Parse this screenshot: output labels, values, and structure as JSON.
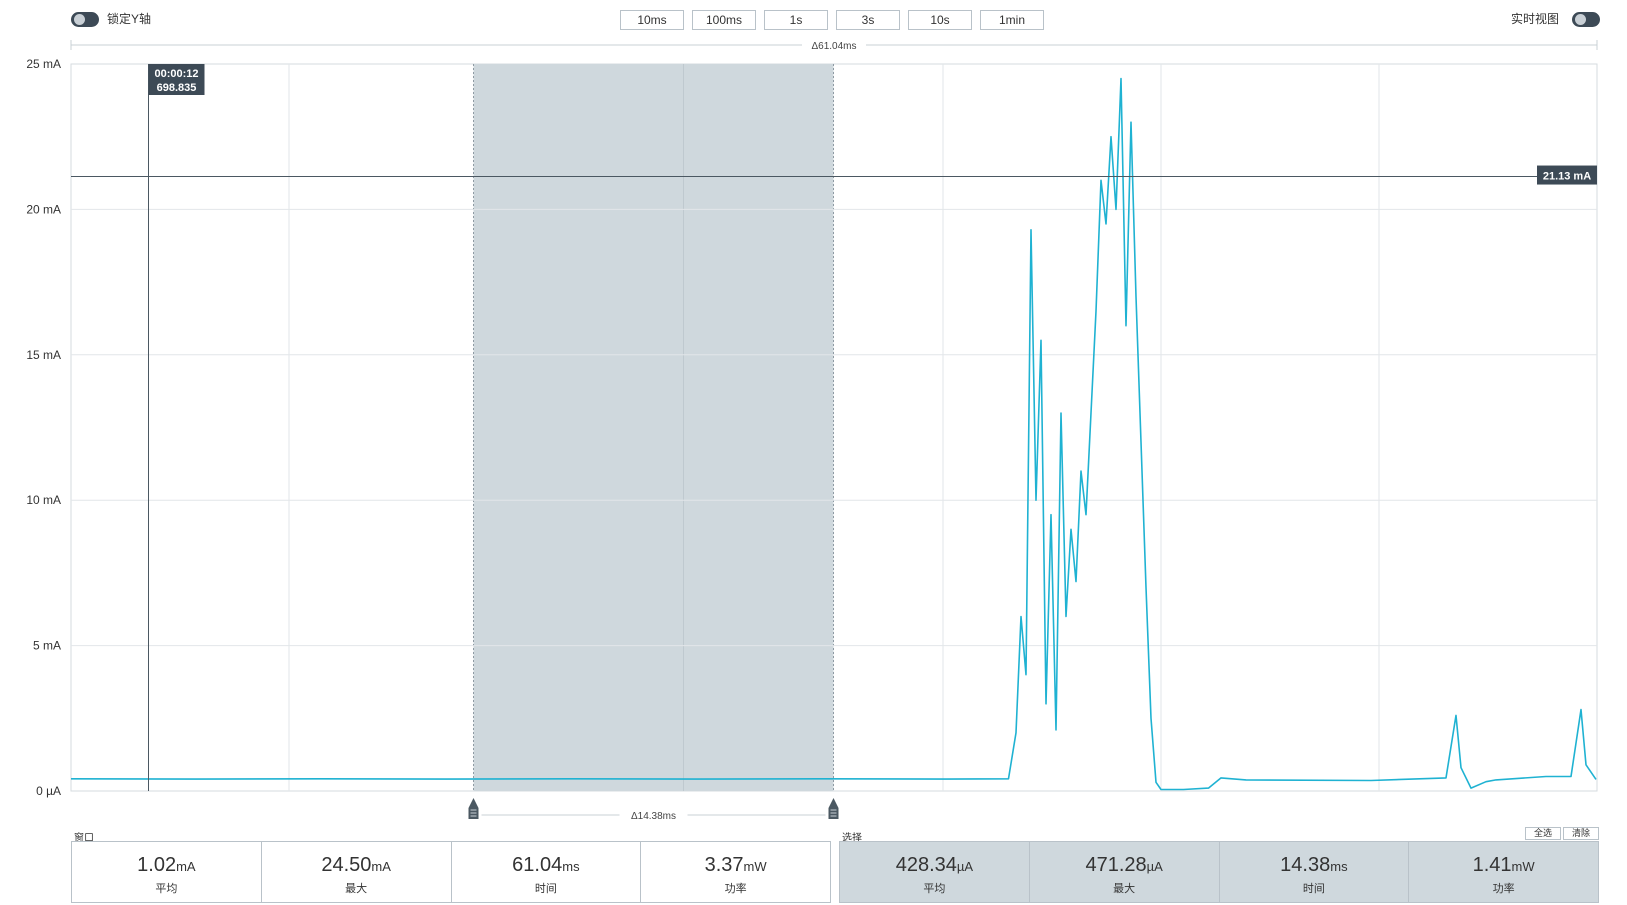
{
  "header": {
    "lock_y_label": "锁定Y轴",
    "realtime_label": "实时视图",
    "window_buttons": [
      "10ms",
      "100ms",
      "1s",
      "3s",
      "10s",
      "1min"
    ]
  },
  "chart_data": {
    "type": "line",
    "ylabel_unit": "mA",
    "yticks": [
      "0 µA",
      "5 mA",
      "10 mA",
      "15 mA",
      "20 mA",
      "25 mA"
    ],
    "ylim": [
      0,
      25
    ],
    "xlim_ms": [
      0,
      61.04
    ],
    "grid": true,
    "window_delta_label": "Δ61.04ms",
    "selection_delta_label": "Δ14.38ms",
    "selection_range_ms": [
      16.1,
      30.5
    ],
    "cursor": {
      "x_ms": 3.1,
      "time": "00:00:12",
      "sub": "698.835"
    },
    "hline": {
      "y_ma": 21.13,
      "label": "21.13 mA"
    },
    "color": "#1fb2d2",
    "x_ms": [
      0,
      5,
      10,
      15,
      20,
      25,
      30,
      35,
      37.5,
      37.8,
      38.0,
      38.2,
      38.4,
      38.6,
      38.8,
      39.0,
      39.2,
      39.4,
      39.6,
      39.8,
      40.0,
      40.2,
      40.4,
      40.6,
      40.8,
      41.0,
      41.2,
      41.4,
      41.6,
      41.8,
      42.0,
      42.2,
      42.4,
      42.6,
      42.8,
      43.0,
      43.2,
      43.4,
      43.6,
      43.8,
      44.0,
      44.2,
      44.5,
      45.5,
      46.0,
      47.0,
      52.0,
      55.0,
      55.4,
      55.6,
      56.0,
      56.6,
      57.0,
      59.0,
      60.0,
      60.4,
      60.6,
      61.0
    ],
    "y_ma": [
      0.42,
      0.41,
      0.42,
      0.41,
      0.42,
      0.41,
      0.42,
      0.41,
      0.42,
      2.0,
      6.0,
      4.0,
      19.3,
      10.0,
      15.5,
      3.0,
      9.5,
      2.1,
      13.0,
      6.0,
      9.0,
      7.2,
      11.0,
      9.5,
      13.0,
      16.5,
      21.0,
      19.5,
      22.5,
      20.0,
      24.5,
      16.0,
      23.0,
      17.0,
      12.0,
      7.0,
      2.5,
      0.3,
      0.05,
      0.05,
      0.05,
      0.05,
      0.05,
      0.1,
      0.45,
      0.38,
      0.36,
      0.45,
      2.6,
      0.8,
      0.1,
      0.32,
      0.38,
      0.5,
      0.5,
      2.8,
      0.9,
      0.4
    ]
  },
  "stats_window": {
    "label": "窗口",
    "items": [
      {
        "value": "1.02",
        "unit": "mA",
        "caption": "平均"
      },
      {
        "value": "24.50",
        "unit": "mA",
        "caption": "最大"
      },
      {
        "value": "61.04",
        "unit": "ms",
        "caption": "时间"
      },
      {
        "value": "3.37",
        "unit": "mW",
        "caption": "功率"
      }
    ]
  },
  "stats_selection": {
    "label": "选择",
    "select_all_label": "全选",
    "clear_label": "清除",
    "items": [
      {
        "value": "428.34",
        "unit": "µA",
        "caption": "平均"
      },
      {
        "value": "471.28",
        "unit": "µA",
        "caption": "最大"
      },
      {
        "value": "14.38",
        "unit": "ms",
        "caption": "时间"
      },
      {
        "value": "1.41",
        "unit": "mW",
        "caption": "功率"
      }
    ]
  }
}
